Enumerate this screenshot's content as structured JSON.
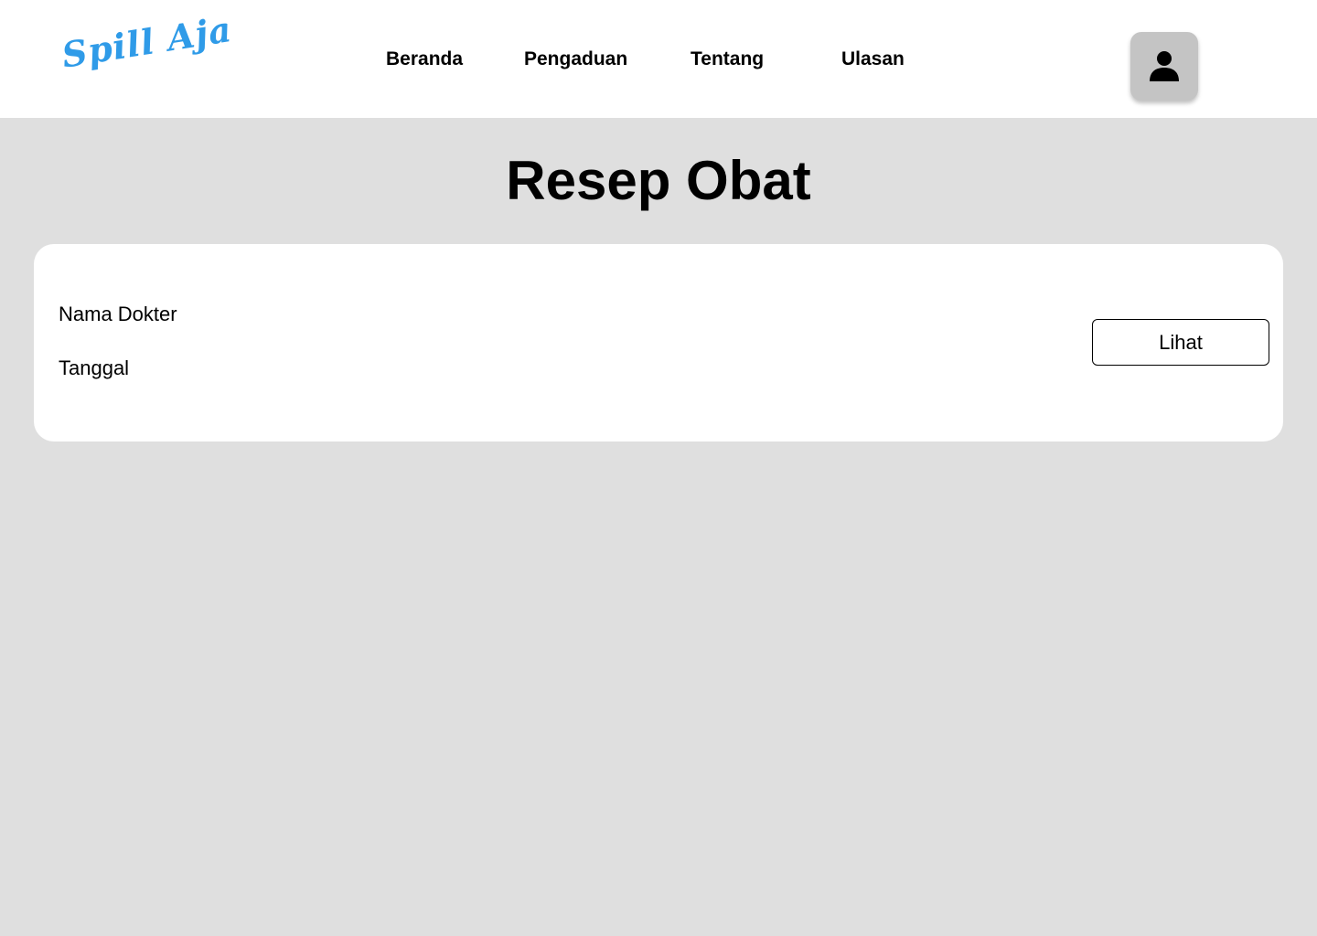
{
  "header": {
    "logo_text": "Spill Aja",
    "brand_color": "#2f9be8",
    "nav": {
      "beranda": "Beranda",
      "pengaduan": "Pengaduan",
      "tentang": "Tentang",
      "ulasan": "Ulasan"
    },
    "profile_icon": "user-icon"
  },
  "main": {
    "title": "Resep Obat",
    "card": {
      "doctor_label": "Nama Dokter",
      "date_label": "Tanggal",
      "view_button": "Lihat"
    }
  }
}
